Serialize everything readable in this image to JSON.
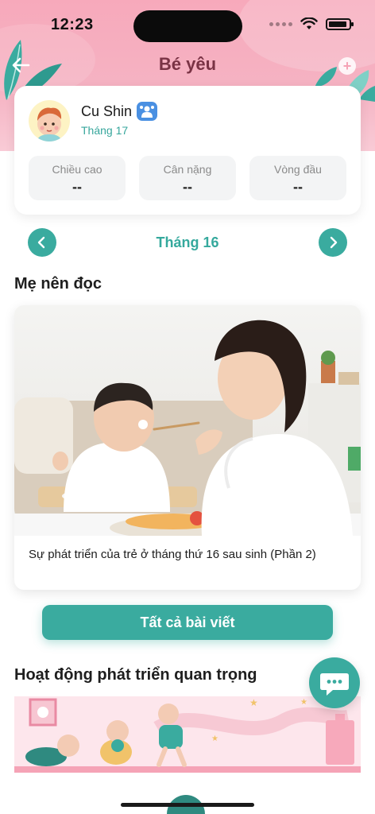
{
  "status_bar": {
    "time": "12:23"
  },
  "header": {
    "title": "Bé yêu"
  },
  "profile": {
    "name": "Cu Shin",
    "age": "Tháng 17",
    "metrics": [
      {
        "label": "Chiều cao",
        "value": "--"
      },
      {
        "label": "Cân nặng",
        "value": "--"
      },
      {
        "label": "Vòng đầu",
        "value": "--"
      }
    ]
  },
  "month_nav": {
    "current": "Tháng 16",
    "prev_icon": "chevron-left-icon",
    "next_icon": "chevron-right-icon"
  },
  "reading": {
    "section_title": "Mẹ nên đọc",
    "article_title": "Sự phát triển của trẻ ở tháng thứ 16 sau sinh (Phần 2)",
    "all_button": "Tất cả bài viết"
  },
  "activities": {
    "section_title": "Hoạt động phát triển quan trọng"
  },
  "colors": {
    "accent": "#3aab9f",
    "header_pink": "#f7a9bb",
    "title": "#7a3345"
  }
}
